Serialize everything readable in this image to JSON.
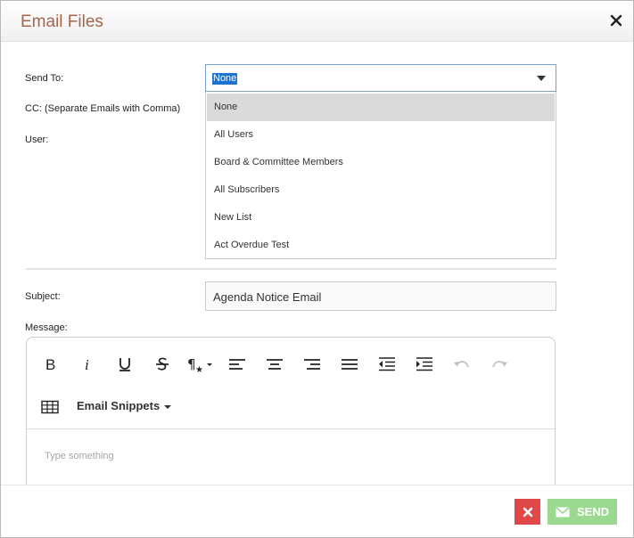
{
  "dialog": {
    "title": "Email Files"
  },
  "form": {
    "send_to_label": "Send To:",
    "send_to_value": "None",
    "send_to_options": [
      "None",
      "All Users",
      "Board & Committee Members",
      "All Subscribers",
      "New List",
      "Act Overdue Test"
    ],
    "cc_label": "CC: (Separate Emails with Comma)",
    "user_label": "User:",
    "subject_label": "Subject:",
    "subject_value": "Agenda Notice Email",
    "message_label": "Message:"
  },
  "editor": {
    "toolbar": [
      "bold-icon",
      "italic-icon",
      "underline-icon",
      "strikethrough-icon",
      "paragraph-format-icon",
      "align-left-icon",
      "align-center-icon",
      "align-right-icon",
      "align-justify-icon",
      "outdent-icon",
      "indent-icon",
      "undo-icon",
      "redo-icon",
      "table-icon"
    ],
    "snippets_label": "Email Snippets",
    "placeholder": "Type something"
  },
  "footer": {
    "send_label": "SEND"
  },
  "colors": {
    "title": "#a4654a",
    "selection": "#1e72d2",
    "cancel": "#e04848",
    "send": "#9bd890"
  }
}
